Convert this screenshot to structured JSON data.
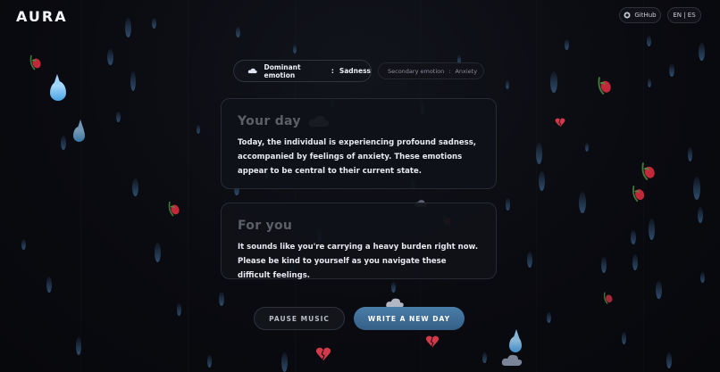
{
  "header": {
    "logo": "AURA",
    "github_label": "GitHub",
    "language_label": "EN | ES"
  },
  "emotions": {
    "dominant_label": "Dominant emotion",
    "dominant_separator": ":",
    "dominant_value": "Sadness",
    "secondary_label": "Secondary emotion",
    "secondary_separator": ":",
    "secondary_value": "Anxiety"
  },
  "cards": {
    "your_day_title": "Your day",
    "your_day_text": "Today, the individual is experiencing profound sadness, accompanied by feelings of anxiety. These emotions appear to be central to their current state.",
    "for_you_title": "For you",
    "for_you_text": "It sounds like you're carrying a heavy burden right now. Please be kind to yourself as you navigate these difficult feelings."
  },
  "actions": {
    "pause_music": "PAUSE MUSIC",
    "write_new_day": "WRITE A NEW DAY"
  },
  "colors": {
    "primary_button": "#3d6e98",
    "background": "#0a0b10",
    "raindrop": "#3a628c",
    "heart": "#d2394b"
  }
}
